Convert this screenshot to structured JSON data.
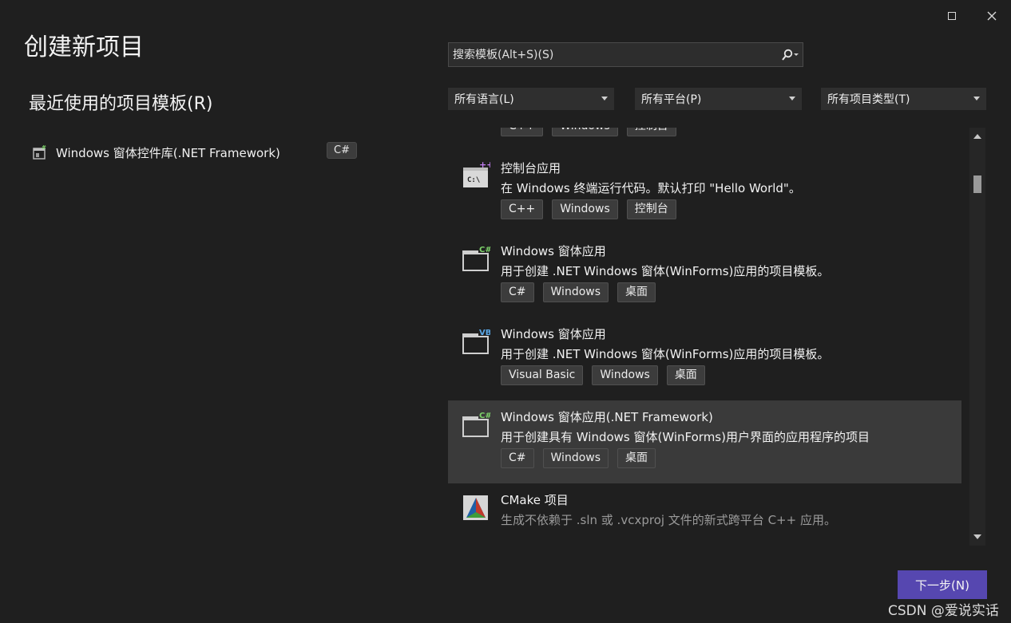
{
  "page_title": "创建新项目",
  "recent": {
    "heading": "最近使用的项目模板(R)",
    "items": [
      {
        "label": "Windows 窗体控件库(.NET Framework)",
        "tag": "C#",
        "icon": "winforms-control-library-icon"
      }
    ]
  },
  "search": {
    "placeholder": "搜索模板(Alt+S)(S)"
  },
  "filters": {
    "language": "所有语言(L)",
    "platform": "所有平台(P)",
    "project_type": "所有项目类型(T)"
  },
  "templates": [
    {
      "title": "",
      "desc": "",
      "tags": [
        "C++",
        "Windows",
        "控制台"
      ],
      "icon": "cpp-template-icon"
    },
    {
      "title": "控制台应用",
      "desc": "在 Windows 终端运行代码。默认打印 \"Hello World\"。",
      "tags": [
        "C++",
        "Windows",
        "控制台"
      ],
      "icon": "console-app-icon",
      "badge": "++"
    },
    {
      "title": "Windows 窗体应用",
      "desc": "用于创建 .NET Windows 窗体(WinForms)应用的项目模板。",
      "tags": [
        "C#",
        "Windows",
        "桌面"
      ],
      "icon": "winforms-csharp-icon",
      "badge": "C#"
    },
    {
      "title": "Windows 窗体应用",
      "desc": "用于创建 .NET Windows 窗体(WinForms)应用的项目模板。",
      "tags": [
        "Visual Basic",
        "Windows",
        "桌面"
      ],
      "icon": "winforms-vb-icon",
      "badge": "VB"
    },
    {
      "title": "Windows 窗体应用(.NET Framework)",
      "desc": "用于创建具有 Windows 窗体(WinForms)用户界面的应用程序的项目",
      "tags": [
        "C#",
        "Windows",
        "桌面"
      ],
      "icon": "winforms-netfx-icon",
      "badge": "C#",
      "selected": true
    },
    {
      "title": "CMake 项目",
      "desc": "生成不依赖于 .sln 或 .vcxproj 文件的新式跨平台 C++ 应用。",
      "tags": [],
      "icon": "cmake-icon"
    }
  ],
  "next_button": "下一步(N)",
  "watermark": "CSDN @爱说实话",
  "colors": {
    "accent": "#5647b0",
    "csharp_badge": "#7ed36b",
    "cpp_badge": "#c27ef2",
    "vb_badge": "#5aa7e6"
  }
}
